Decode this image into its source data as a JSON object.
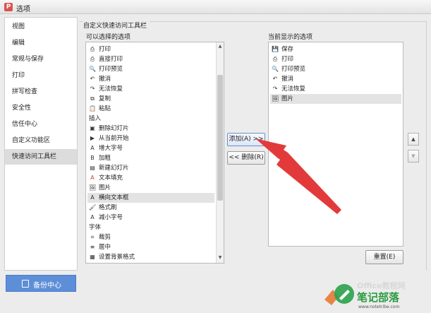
{
  "window": {
    "title": "选项",
    "icon": "wps-app-icon"
  },
  "nav": {
    "items": [
      {
        "label": "视图"
      },
      {
        "label": "编辑"
      },
      {
        "label": "常规与保存"
      },
      {
        "label": "打印"
      },
      {
        "label": "拼写检查"
      },
      {
        "label": "安全性"
      },
      {
        "label": "信任中心"
      },
      {
        "label": "自定义功能区"
      },
      {
        "label": "快速访问工具栏",
        "selected": true
      }
    ]
  },
  "backup": {
    "label": "备份中心"
  },
  "qat": {
    "group_title": "自定义快速访问工具栏",
    "available_label": "可以选择的选项",
    "current_label": "当前显示的选项",
    "available": [
      {
        "icon": "⎙",
        "label": "打印"
      },
      {
        "icon": "⎙",
        "label": "直接打印"
      },
      {
        "icon": "🔍",
        "label": "打印预览"
      },
      {
        "icon": "↶",
        "label": "撤消"
      },
      {
        "icon": "↷",
        "label": "无法恢复"
      },
      {
        "icon": "⧉",
        "label": "复制"
      },
      {
        "icon": "📋",
        "label": "粘贴"
      },
      {
        "icon": "",
        "label": "插入",
        "section": true
      },
      {
        "icon": "▣",
        "label": "删除幻灯片"
      },
      {
        "icon": "▶",
        "label": "从当前开始"
      },
      {
        "icon": "A",
        "label": "增大字号"
      },
      {
        "icon": "B",
        "label": "加粗"
      },
      {
        "icon": "▤",
        "label": "新建幻灯片"
      },
      {
        "icon": "A",
        "label": "文本填充"
      },
      {
        "icon": "🖼",
        "label": "图片"
      },
      {
        "icon": "A",
        "label": "横向文本框",
        "selected": true
      },
      {
        "icon": "🖌",
        "label": "格式刷"
      },
      {
        "icon": "A",
        "label": "减小字号"
      },
      {
        "icon": "",
        "label": "字体",
        "section": true
      },
      {
        "icon": "⌗",
        "label": "裁剪"
      },
      {
        "icon": "≡",
        "label": "居中"
      },
      {
        "icon": "▦",
        "label": "设置背景格式"
      }
    ],
    "current": [
      {
        "icon": "💾",
        "label": "保存"
      },
      {
        "icon": "⎙",
        "label": "打印"
      },
      {
        "icon": "🔍",
        "label": "打印预览"
      },
      {
        "icon": "↶",
        "label": "撤消"
      },
      {
        "icon": "↷",
        "label": "无法恢复"
      },
      {
        "icon": "🖼",
        "label": "图片",
        "selected": true
      }
    ],
    "add_label": "添加(A) >>",
    "remove_label": "<< 删除(R)",
    "reset_label": "重置(E)"
  },
  "watermark": {
    "line1": "Office教程网",
    "line2": "笔记部落",
    "url": "www.notetribe.com"
  },
  "colors": {
    "arrow": "#e23a3a",
    "nav_selected": "#dcdcdc",
    "backup_bg": "#5d8ed8"
  }
}
